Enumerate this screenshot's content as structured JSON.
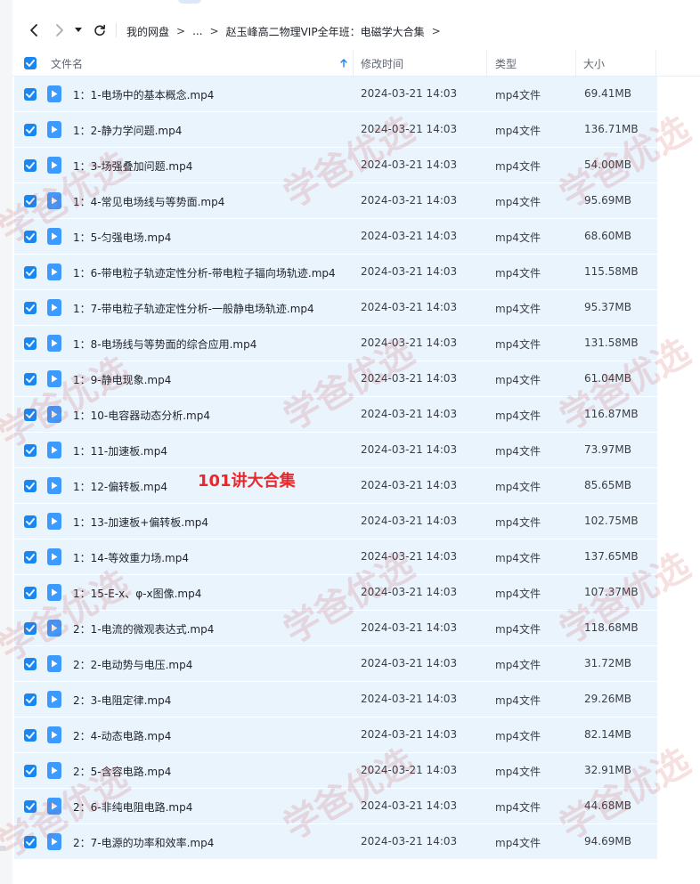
{
  "toolbar": {
    "breadcrumb": [
      "我的网盘",
      "...",
      "赵玉峰高二物理VIP全年班：电磁学大合集"
    ]
  },
  "table": {
    "headers": {
      "name": "文件名",
      "modified": "修改时间",
      "type": "类型",
      "size": "大小"
    },
    "rows": [
      {
        "name": "1：1-电场中的基本概念.mp4",
        "date": "2024-03-21 14:03",
        "type": "mp4文件",
        "size": "69.41MB"
      },
      {
        "name": "1：2-静力学问题.mp4",
        "date": "2024-03-21 14:03",
        "type": "mp4文件",
        "size": "136.71MB"
      },
      {
        "name": "1：3-场强叠加问题.mp4",
        "date": "2024-03-21 14:03",
        "type": "mp4文件",
        "size": "54.00MB"
      },
      {
        "name": "1：4-常见电场线与等势面.mp4",
        "date": "2024-03-21 14:03",
        "type": "mp4文件",
        "size": "95.69MB"
      },
      {
        "name": "1：5-匀强电场.mp4",
        "date": "2024-03-21 14:03",
        "type": "mp4文件",
        "size": "68.60MB"
      },
      {
        "name": "1：6-带电粒子轨迹定性分析-带电粒子辐向场轨迹.mp4",
        "date": "2024-03-21 14:03",
        "type": "mp4文件",
        "size": "115.58MB"
      },
      {
        "name": "1：7-带电粒子轨迹定性分析-一般静电场轨迹.mp4",
        "date": "2024-03-21 14:03",
        "type": "mp4文件",
        "size": "95.37MB"
      },
      {
        "name": "1：8-电场线与等势面的综合应用.mp4",
        "date": "2024-03-21 14:03",
        "type": "mp4文件",
        "size": "131.58MB"
      },
      {
        "name": "1：9-静电现象.mp4",
        "date": "2024-03-21 14:03",
        "type": "mp4文件",
        "size": "61.04MB"
      },
      {
        "name": "1：10-电容器动态分析.mp4",
        "date": "2024-03-21 14:03",
        "type": "mp4文件",
        "size": "116.87MB"
      },
      {
        "name": "1：11-加速板.mp4",
        "date": "2024-03-21 14:03",
        "type": "mp4文件",
        "size": "73.97MB"
      },
      {
        "name": "1：12-偏转板.mp4",
        "date": "2024-03-21 14:03",
        "type": "mp4文件",
        "size": "85.65MB"
      },
      {
        "name": "1：13-加速板+偏转板.mp4",
        "date": "2024-03-21 14:03",
        "type": "mp4文件",
        "size": "102.75MB"
      },
      {
        "name": "1：14-等效重力场.mp4",
        "date": "2024-03-21 14:03",
        "type": "mp4文件",
        "size": "137.65MB"
      },
      {
        "name": "1：15-E-x、φ-x图像.mp4",
        "date": "2024-03-21 14:03",
        "type": "mp4文件",
        "size": "107.37MB"
      },
      {
        "name": "2：1-电流的微观表达式.mp4",
        "date": "2024-03-21 14:03",
        "type": "mp4文件",
        "size": "118.68MB"
      },
      {
        "name": "2：2-电动势与电压.mp4",
        "date": "2024-03-21 14:03",
        "type": "mp4文件",
        "size": "31.72MB"
      },
      {
        "name": "2：3-电阻定律.mp4",
        "date": "2024-03-21 14:03",
        "type": "mp4文件",
        "size": "29.26MB"
      },
      {
        "name": "2：4-动态电路.mp4",
        "date": "2024-03-21 14:03",
        "type": "mp4文件",
        "size": "82.14MB"
      },
      {
        "name": "2：5-含容电路.mp4",
        "date": "2024-03-21 14:03",
        "type": "mp4文件",
        "size": "32.91MB"
      },
      {
        "name": "2：6-非纯电阻电路.mp4",
        "date": "2024-03-21 14:03",
        "type": "mp4文件",
        "size": "44.68MB"
      },
      {
        "name": "2：7-电源的功率和效率.mp4",
        "date": "2024-03-21 14:03",
        "type": "mp4文件",
        "size": "94.69MB"
      }
    ]
  },
  "annotation": "101讲大合集",
  "watermark": "学爸优选",
  "colors": {
    "accent": "#1a86f0",
    "row_selected": "#eaf4fd",
    "annotation": "#e8282b"
  },
  "icons": {
    "back": "chevron-left-icon",
    "forward": "chevron-right-icon",
    "history": "caret-down-icon",
    "refresh": "refresh-icon",
    "file": "video-file-icon",
    "sort": "sort-arrow-icon"
  }
}
